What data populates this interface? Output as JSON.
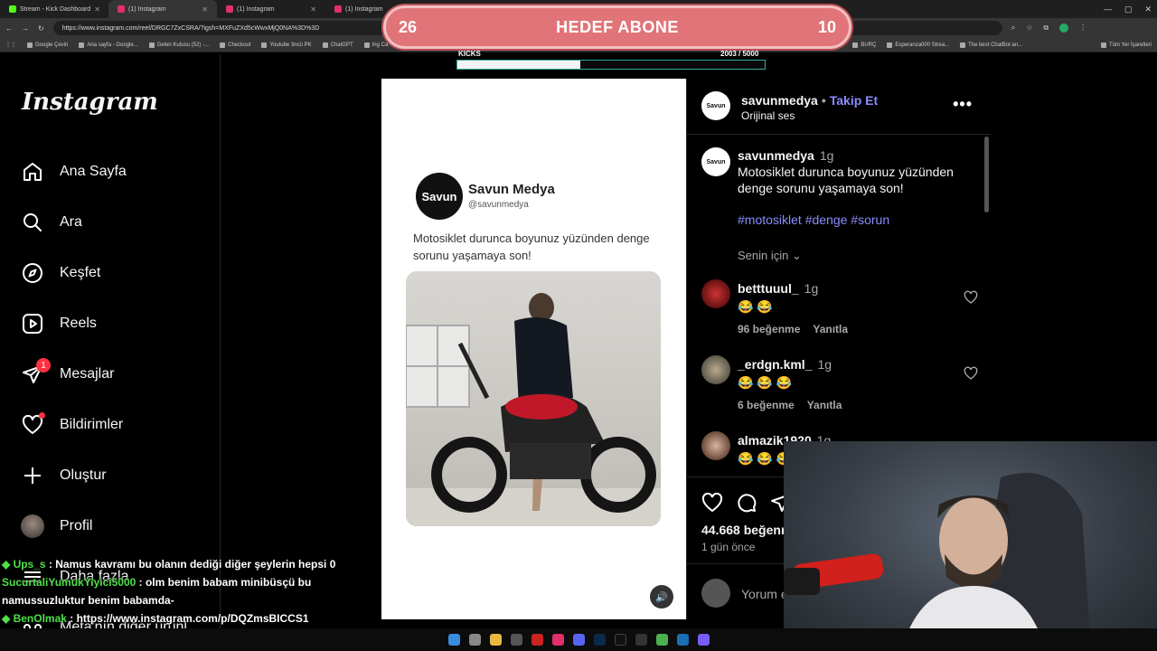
{
  "browser": {
    "tabs": [
      {
        "label": "Stream - Kick Dashboard",
        "color": "#53fc18",
        "active": false
      },
      {
        "label": "(1) Instagram",
        "color": "#e1306c",
        "active": true
      },
      {
        "label": "(1) Instagram",
        "color": "#e1306c",
        "active": false
      },
      {
        "label": "(1) Instagram",
        "color": "#e1306c",
        "active": false
      }
    ],
    "url": "https://www.instagram.com/reel/DRGC7ZxCSRA/?igsh=MXFuZXd5cWwxMjQ0NA%3D%3D",
    "bookmarks": [
      "Google Çeviri",
      "Ana sayfa - Google...",
      "Gelen Kutusu (52) -...",
      "Checkout",
      "Youtube 3ncü PK",
      "ChatGPT",
      "Ing Ca",
      "BURÇ",
      "Esperanza000 Strea...",
      "The best ChatBot an...",
      "Tüm Yer İşaretleri"
    ]
  },
  "overlay": {
    "goal_current": "26",
    "goal_title": "HEDEF ABONE",
    "goal_target": "10",
    "kicks_label": "KICKS",
    "kicks_count": "2003   / 5000",
    "kicks_fraction": 0.4006
  },
  "sidebar": {
    "logo": "Instagram",
    "items": [
      {
        "label": "Ana Sayfa",
        "icon": "home-icon"
      },
      {
        "label": "Ara",
        "icon": "search-icon"
      },
      {
        "label": "Keşfet",
        "icon": "compass-icon"
      },
      {
        "label": "Reels",
        "icon": "reels-icon"
      },
      {
        "label": "Mesajlar",
        "icon": "messages-icon",
        "badge": "1"
      },
      {
        "label": "Bildirimler",
        "icon": "heart-icon"
      },
      {
        "label": "Oluştur",
        "icon": "plus-icon"
      },
      {
        "label": "Profil",
        "icon": "profile-avatar"
      },
      {
        "label": "Daha fazla",
        "icon": "menu-icon"
      },
      {
        "label": "Meta'nın diğer ürünl",
        "icon": "meta-icon"
      }
    ]
  },
  "reel": {
    "avatar_text": "Savun",
    "name": "Savun Medya",
    "handle": "@savunmedya",
    "text": "Motosiklet durunca boyunuz yüzünden denge sorunu yaşamaya son!"
  },
  "panel": {
    "username": "savunmedya",
    "follow": "Takip Et",
    "audio": "Orijinal ses",
    "caption_user": "savunmedya",
    "caption_time": "1g",
    "caption_text": "Motosiklet durunca boyunuz yüzünden denge sorunu yaşamaya son!",
    "hashtags": "#motosiklet #denge #sorun",
    "for_you": "Senin için",
    "comments": [
      {
        "user": "betttuuul_",
        "time": "1g",
        "text": "😂 😂",
        "likes": "96 beğenme",
        "reply": "Yanıtla"
      },
      {
        "user": "_erdgn.kml_",
        "time": "1g",
        "text": "😂 😂 😂",
        "likes": "6 beğenme",
        "reply": "Yanıtla"
      },
      {
        "user": "almazik1920",
        "time": "1g",
        "text": "😂 😂 😂",
        "likes": "",
        "reply": ""
      }
    ],
    "likes": "44.668 beğenm",
    "ago": "1 gün önce",
    "comment_placeholder": "Yorum e"
  },
  "chat": [
    {
      "user": "Ups_s",
      "text": ": Namus kavramı bu olanın dediği diğer şeylerin hepsi 0"
    },
    {
      "user": "SucurtaliYumukYiyici5000",
      "text": ": olm benim babam minibüsçü bu namussuzluktur benim babamda-"
    },
    {
      "user": "BenOlmak",
      "text": ": https://www.instagram.com/p/DQZmsBICCS1"
    }
  ],
  "colors": {
    "accent": "#8a8cff",
    "goal_bg": "#e07478",
    "chat_user": "#4fe04a"
  }
}
